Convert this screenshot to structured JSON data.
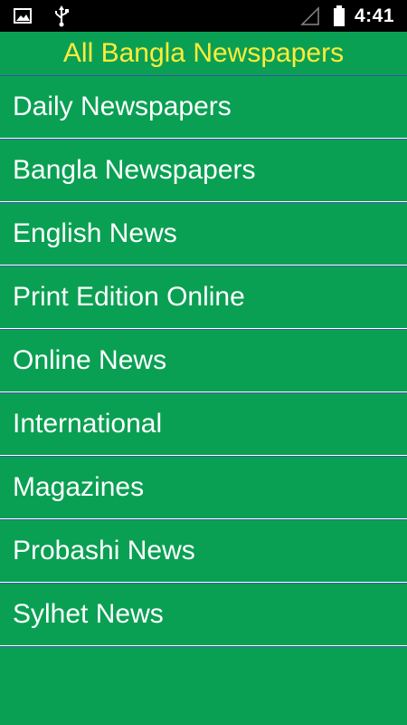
{
  "status_bar": {
    "time": "4:41",
    "icons": [
      "image-notification-icon",
      "usb-icon",
      "signal-icon",
      "battery-icon"
    ]
  },
  "header": {
    "title": "All Bangla Newspapers"
  },
  "menu": {
    "items": [
      {
        "label": "Daily Newspapers"
      },
      {
        "label": "Bangla Newspapers"
      },
      {
        "label": "English News"
      },
      {
        "label": "Print Edition Online"
      },
      {
        "label": "Online News"
      },
      {
        "label": "International"
      },
      {
        "label": "Magazines"
      },
      {
        "label": "Probashi News"
      },
      {
        "label": "Sylhet News"
      }
    ]
  },
  "colors": {
    "background": "#0aa053",
    "title_text": "#ffeb3b",
    "item_text": "#ffffff",
    "status_bar": "#000000"
  }
}
